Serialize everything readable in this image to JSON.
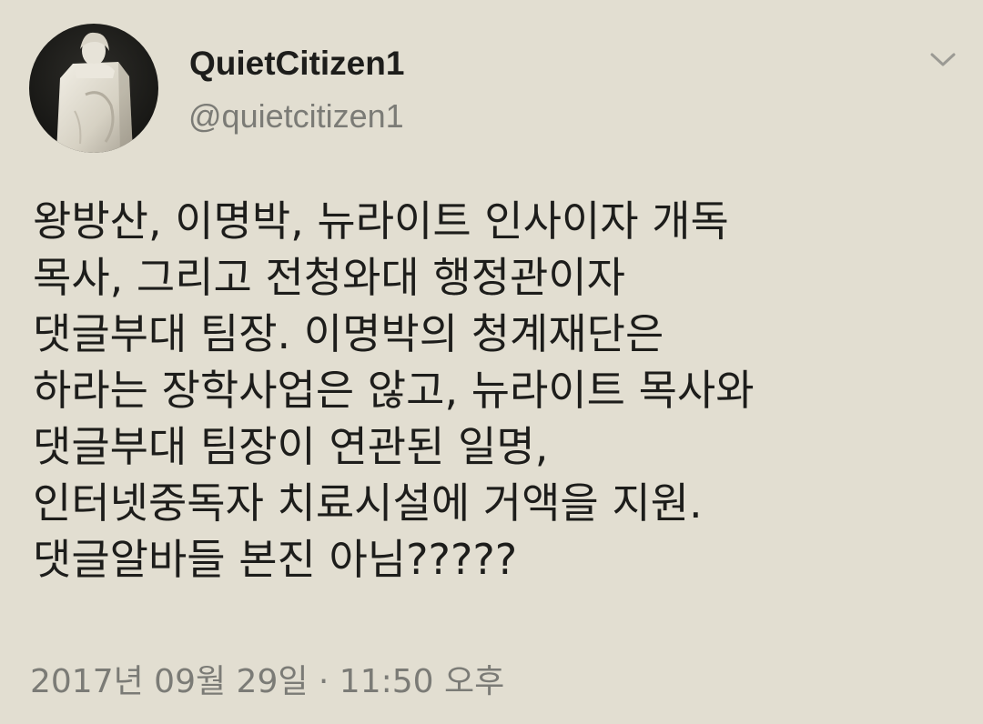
{
  "author": {
    "display_name": "QuietCitizen1",
    "handle": "@quietcitizen1"
  },
  "avatar": {
    "icon": "statue-photo-avatar"
  },
  "menu": {
    "icon": "chevron-down-icon"
  },
  "tweet": {
    "lines": [
      "왕방산, 이명박, 뉴라이트 인사이자 개독",
      "목사, 그리고 전청와대 행정관이자",
      "댓글부대 팀장. 이명박의 청계재단은",
      "하라는 장학사업은 않고, 뉴라이트 목사와",
      "댓글부대 팀장이 연관된 일명,",
      "인터넷중독자 치료시설에 거액을 지원.",
      "댓글알바들 본진 아님?????"
    ]
  },
  "meta": {
    "timestamp": "2017년 09월 29일 · 11:50 오후"
  },
  "colors": {
    "background": "#e2ded1",
    "text_primary": "#1d1d1b",
    "text_secondary": "#7b7b76"
  }
}
